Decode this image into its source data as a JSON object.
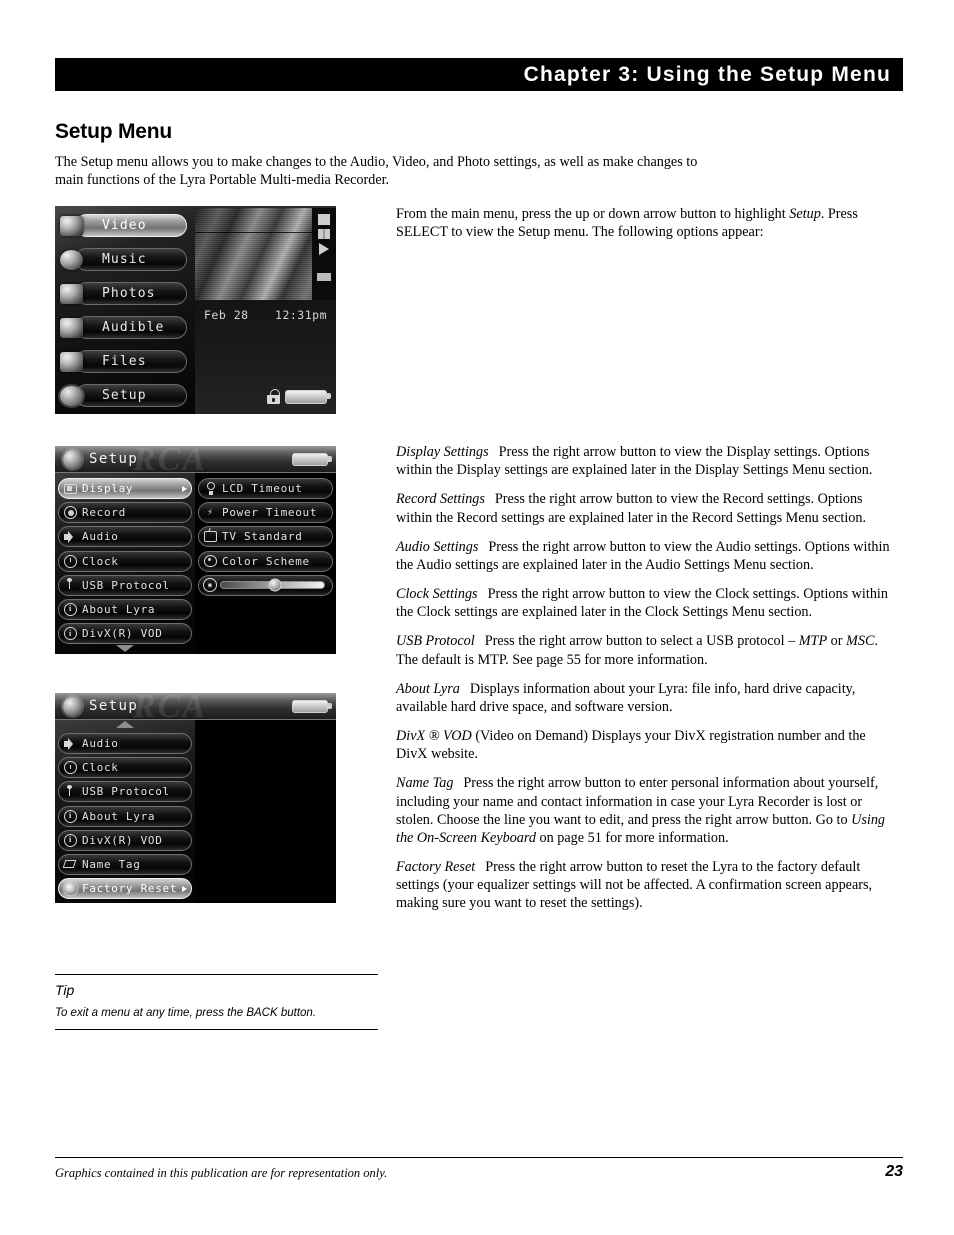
{
  "chapter": {
    "title": "Chapter 3: Using the Setup Menu"
  },
  "page_title": "Setup Menu",
  "intro": "The Setup menu allows you to make changes to the Audio, Video, and Photo settings, as well as make changes to main functions of the Lyra Portable Multi-media Recorder.",
  "body": {
    "intro_paragraph_pre": "From the main menu, press the up or down arrow button to highlight ",
    "intro_paragraph_italic": "Setup",
    "intro_paragraph_post": ". Press SELECT to view the Setup menu. The following options appear:",
    "entries": [
      {
        "term": "Display Settings",
        "text": "Press the right arrow button to view the Display settings. Options within the Display settings are explained later in the Display Settings Menu section."
      },
      {
        "term": "Record Settings",
        "text": "Press the right arrow button to view the Record settings. Options within the Record settings are explained later in the Record Settings Menu section."
      },
      {
        "term": "Audio Settings",
        "text": "Press the right arrow button to view the Audio settings. Options within the Audio settings are explained later in the Audio Settings Menu section."
      },
      {
        "term": "Clock Settings",
        "text": "Press the right arrow button to view the Clock settings. Options within the Clock settings are explained later in the Clock Settings Menu section."
      },
      {
        "term": "USB Protocol",
        "text_a": "Press the right arrow button to select a USB protocol – ",
        "italic_a": "MTP",
        "text_b": " or ",
        "italic_b": "MSC",
        "text_c": ". The default is MTP. See page 55 for more information."
      },
      {
        "term": "About Lyra",
        "text": "Displays information about your Lyra: file info, hard drive capacity, available hard drive space, and software version."
      },
      {
        "term": "DivX ® VOD",
        "text": "(Video on Demand)   Displays your DivX registration number and the DivX website."
      },
      {
        "term": "Name Tag",
        "text_a": "Press the right arrow button to enter personal information about yourself, including your name and contact information in case your Lyra Recorder is lost or stolen. Choose the line you want to edit, and press the right arrow button. Go to ",
        "italic_a": "Using the On-Screen Keyboard",
        "text_b": " on page 51 for more information."
      },
      {
        "term": "Factory Reset",
        "text": "Press the right arrow button to reset the Lyra to the factory default settings (your equalizer settings will not be affected. A confirmation screen appears, making sure you want to reset the settings)."
      }
    ]
  },
  "device_main_menu": {
    "items": [
      {
        "label": "Video",
        "icon": "camcorder-icon",
        "selected": true
      },
      {
        "label": "Music",
        "icon": "headphones-icon",
        "selected": false
      },
      {
        "label": "Photos",
        "icon": "camera-icon",
        "selected": false
      },
      {
        "label": "Audible",
        "icon": "speaker-box-icon",
        "selected": false
      },
      {
        "label": "Files",
        "icon": "folder-icon",
        "selected": false
      },
      {
        "label": "Setup",
        "icon": "gear-icon",
        "selected": false
      }
    ],
    "status": {
      "date": "Feb 28",
      "time": "12:31pm",
      "lock_icon": "lock-icon",
      "battery_icon": "battery-icon"
    }
  },
  "device_setup_page1": {
    "header": {
      "title": "Setup",
      "icon": "gear-icon",
      "battery_icon": "battery-icon",
      "watermark": "RCA"
    },
    "left_items": [
      {
        "label": "Display",
        "icon": "display-icon",
        "selected": true
      },
      {
        "label": "Record",
        "icon": "record-icon",
        "selected": false
      },
      {
        "label": "Audio",
        "icon": "speaker-icon",
        "selected": false
      },
      {
        "label": "Clock",
        "icon": "clock-icon",
        "selected": false
      },
      {
        "label": "USB Protocol",
        "icon": "usb-icon",
        "selected": false
      },
      {
        "label": "About Lyra",
        "icon": "info-icon",
        "selected": false
      },
      {
        "label": "DivX(R) VOD",
        "icon": "info-icon",
        "selected": false
      }
    ],
    "right_items": [
      {
        "label": "LCD Timeout",
        "icon": "bulb-icon"
      },
      {
        "label": "Power Timeout",
        "icon": "bolt-icon"
      },
      {
        "label": "TV Standard",
        "icon": "tv-icon"
      },
      {
        "label": "Color Scheme",
        "icon": "palette-icon"
      }
    ],
    "volume_slider": {
      "icon": "volume-icon",
      "value_percent": 52
    },
    "scroll_down_icon": "chevron-down-icon"
  },
  "device_setup_page2": {
    "header": {
      "title": "Setup",
      "icon": "gear-icon",
      "battery_icon": "battery-icon",
      "watermark": "RCA"
    },
    "left_items": [
      {
        "label": "Audio",
        "icon": "speaker-icon",
        "selected": false
      },
      {
        "label": "Clock",
        "icon": "clock-icon",
        "selected": false
      },
      {
        "label": "USB Protocol",
        "icon": "usb-icon",
        "selected": false
      },
      {
        "label": "About Lyra",
        "icon": "info-icon",
        "selected": false
      },
      {
        "label": "DivX(R) VOD",
        "icon": "info-icon",
        "selected": false
      },
      {
        "label": "Name Tag",
        "icon": "tag-icon",
        "selected": false
      },
      {
        "label": "Factory Reset",
        "icon": "flower-icon",
        "selected": true
      }
    ],
    "scroll_up_icon": "chevron-up-icon"
  },
  "tip": {
    "label": "Tip",
    "text": "To exit a menu at any time, press the BACK button."
  },
  "footer": {
    "note": "Graphics contained in this publication are for representation only.",
    "page_number": "23"
  }
}
